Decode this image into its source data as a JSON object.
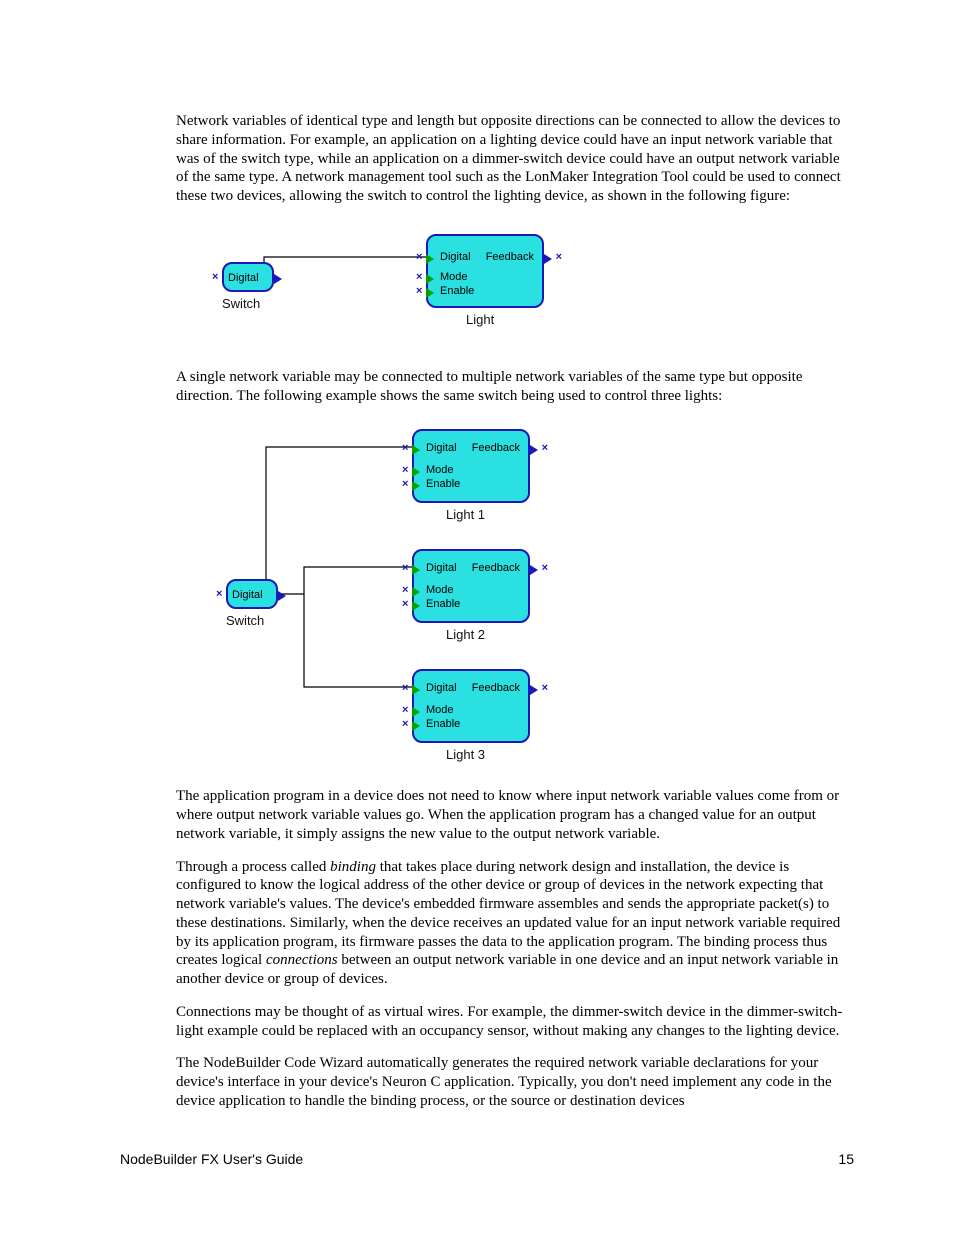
{
  "paragraphs": {
    "p1": "Network variables of identical type and length but opposite directions can be connected to allow the devices to share information.  For example, an application on a lighting device could have an input network variable that was of the switch type, while an application on a dimmer-switch device could have an output network variable of the same type.  A network management tool such as the LonMaker Integration Tool could be used to connect these two devices, allowing the switch to control the lighting device, as shown in the following figure:",
    "p2": "A single network variable may be connected to multiple network variables of the same type but opposite direction.  The following example shows the same switch being used to control three lights:",
    "p3": "The application program in a device does not need to know where input network variable values come from or where output network variable values go.  When the application program has a changed value for an output network variable, it simply assigns the new value to the output network variable.",
    "p4_a": "Through a process called ",
    "p4_bind": "binding",
    "p4_b": " that takes place during network design and installation, the device is configured to know the logical address of the other device or group of devices in the network expecting that network variable's values.  The device's embedded firmware assembles and sends the appropriate packet(s) to these destinations.  Similarly, when the device receives an updated value for an input network variable required by its application program, its firmware passes the data to the application program.  The binding process thus creates logical ",
    "p4_conn": "connections",
    "p4_c": " between an output network variable in one device and an input network variable in another device or group of devices.",
    "p5": "Connections may be thought of as virtual wires.  For example, the dimmer-switch device in the dimmer-switch-light example could be replaced with an occupancy sensor, without making any changes to the lighting device.",
    "p6": "The NodeBuilder Code Wizard automatically generates the required network variable declarations for your device's interface in your device's Neuron C application.  Typically, you don't need implement any code in the device application to handle the binding process, or the source or destination devices"
  },
  "diagram1": {
    "switch": {
      "caption": "Switch",
      "port": "Digital"
    },
    "light": {
      "caption": "Light",
      "inputs": [
        "Digital",
        "Mode",
        "Enable"
      ],
      "output": "Feedback"
    }
  },
  "diagram2": {
    "switch": {
      "caption": "Switch",
      "port": "Digital"
    },
    "lights": [
      {
        "caption": "Light 1",
        "inputs": [
          "Digital",
          "Mode",
          "Enable"
        ],
        "output": "Feedback"
      },
      {
        "caption": "Light 2",
        "inputs": [
          "Digital",
          "Mode",
          "Enable"
        ],
        "output": "Feedback"
      },
      {
        "caption": "Light 3",
        "inputs": [
          "Digital",
          "Mode",
          "Enable"
        ],
        "output": "Feedback"
      }
    ]
  },
  "footer": {
    "title": "NodeBuilder FX User's Guide",
    "page": "15"
  }
}
